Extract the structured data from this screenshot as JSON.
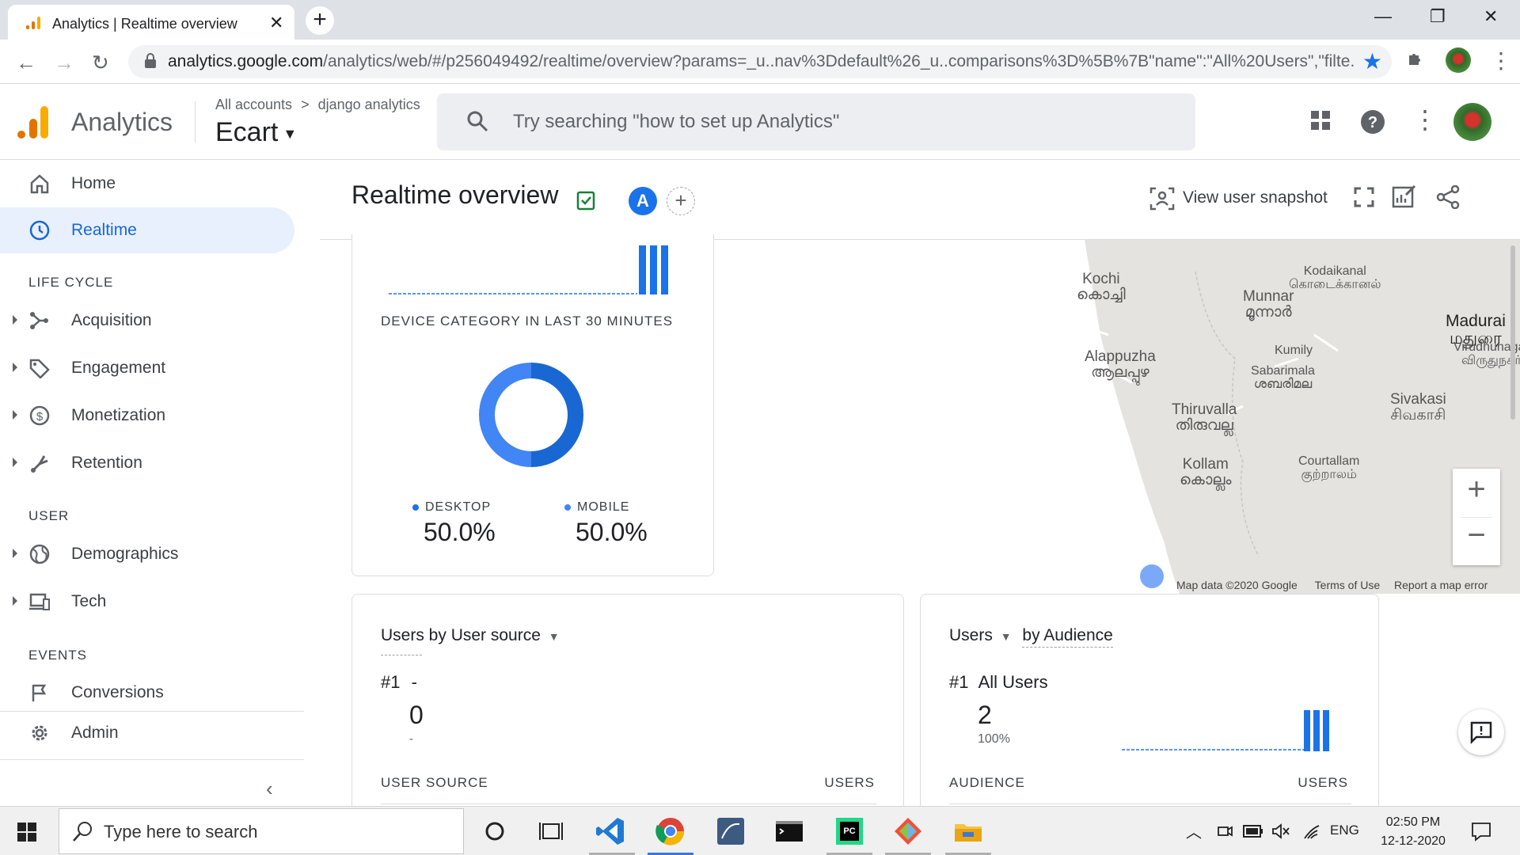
{
  "browser": {
    "tab_title": "Analytics | Realtime overview",
    "url_host": "analytics.google.com",
    "url_path": "/analytics/web/#/p256049492/realtime/overview?params=_u..nav%3Ddefault%26_u..comparisons%3D%5B%7B\"name\":\"All%20Users\",\"filte..."
  },
  "header": {
    "app_name": "Analytics",
    "breadcrumb_root": "All accounts",
    "breadcrumb_sep": ">",
    "breadcrumb_account": "django analytics",
    "property": "Ecart",
    "search_placeholder": "Try searching \"how to set up Analytics\""
  },
  "sidebar": {
    "home": "Home",
    "realtime": "Realtime",
    "section_lifecycle": "LIFE CYCLE",
    "acquisition": "Acquisition",
    "engagement": "Engagement",
    "monetization": "Monetization",
    "retention": "Retention",
    "section_user": "USER",
    "demographics": "Demographics",
    "tech": "Tech",
    "section_events": "EVENTS",
    "conversions": "Conversions",
    "admin": "Admin"
  },
  "page": {
    "title": "Realtime overview",
    "compare_badge": "A",
    "view_snapshot": "View user snapshot"
  },
  "device_card": {
    "title": "DEVICE CATEGORY IN LAST 30 MINUTES",
    "legend": [
      {
        "label": "DESKTOP",
        "value": "50.0%",
        "color": "#1a73e8"
      },
      {
        "label": "MOBILE",
        "value": "50.0%",
        "color": "#4285f4"
      }
    ]
  },
  "chart_data": {
    "type": "pie",
    "categories": [
      "DESKTOP",
      "MOBILE"
    ],
    "values": [
      50.0,
      50.0
    ],
    "title": "DEVICE CATEGORY IN LAST 30 MINUTES"
  },
  "map": {
    "labels": [
      {
        "text": "Kochi",
        "sub": "കൊച്ചി"
      },
      {
        "text": "Munnar",
        "sub": "മൂന്നാർ"
      },
      {
        "text": "Kodaikanal",
        "sub": "கொடைக்கானல்"
      },
      {
        "text": "Madurai",
        "sub": "மதுரை"
      },
      {
        "text": "Alappuzha",
        "sub": "ആലപ്പുഴ"
      },
      {
        "text": "Kumily",
        "sub": ""
      },
      {
        "text": "Sabarimala",
        "sub": "ശബരിമല"
      },
      {
        "text": "Virudhunagar",
        "sub": "விருதுநகர்"
      },
      {
        "text": "Thiruvalla",
        "sub": "തിരുവല്ല"
      },
      {
        "text": "Sivakasi",
        "sub": "சிவகாசி"
      },
      {
        "text": "Kollam",
        "sub": "കൊല്ലം"
      },
      {
        "text": "Courtallam",
        "sub": "குற்றாலம்"
      }
    ],
    "attribution": "Map data ©2020 Google",
    "terms": "Terms of Use",
    "report": "Report a map error"
  },
  "user_source_card": {
    "title_prefix": "Users by",
    "title_dim": "User source",
    "rank": "#1",
    "top_name": "-",
    "top_value": "0",
    "top_sub": "-",
    "col_left": "USER SOURCE",
    "col_right": "USERS"
  },
  "audience_card": {
    "title_metric": "Users",
    "title_dim": "by Audience",
    "rank": "#1",
    "top_name": "All Users",
    "top_value": "2",
    "top_sub": "100%",
    "col_left": "AUDIENCE",
    "col_right": "USERS"
  },
  "taskbar": {
    "search_placeholder": "Type here to search",
    "lang": "ENG",
    "time": "02:50 PM",
    "date": "12-12-2020"
  }
}
